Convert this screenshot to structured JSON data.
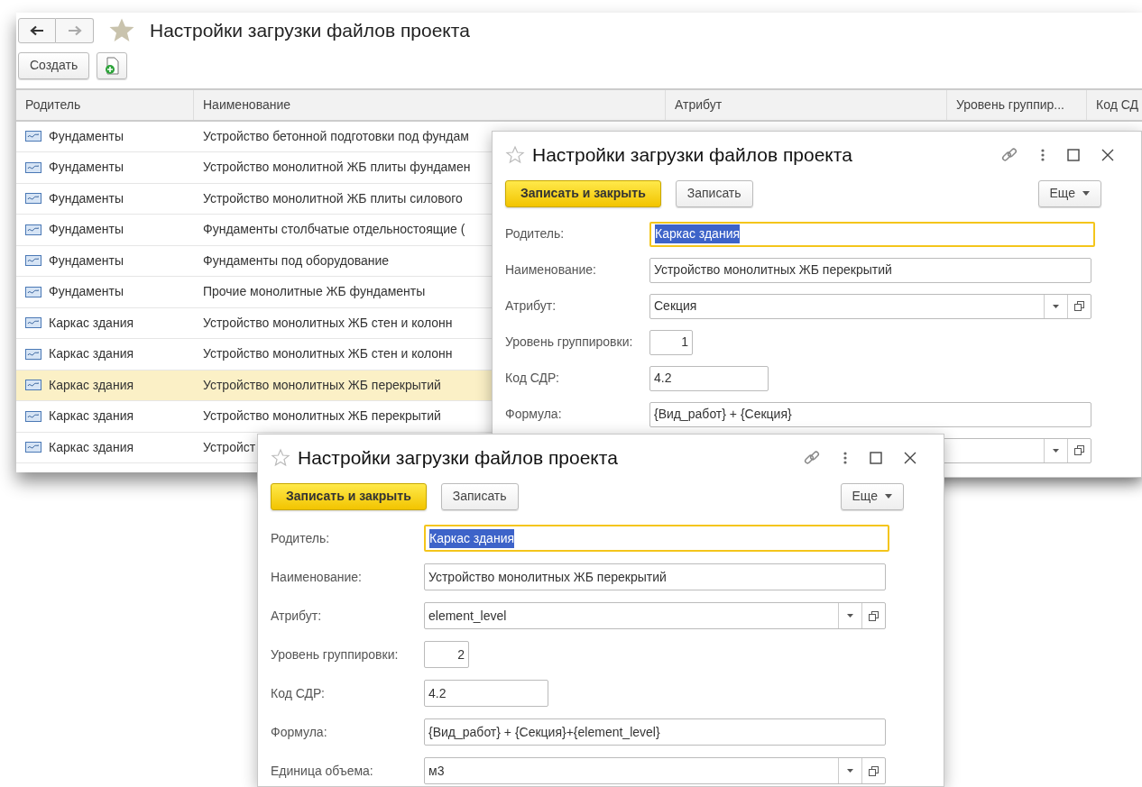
{
  "list_window": {
    "title": "Настройки загрузки файлов проекта",
    "create_button": "Создать",
    "columns": [
      "Родитель",
      "Наименование",
      "Атрибут",
      "Уровень группир...",
      "Код СД"
    ],
    "rows": [
      {
        "parent": "Фундаменты",
        "name": "Устройство бетонной подготовки под фундам",
        "selected": false
      },
      {
        "parent": "Фундаменты",
        "name": "Устройство монолитной ЖБ плиты фундамен",
        "selected": false
      },
      {
        "parent": "Фундаменты",
        "name": "Устройство монолитной ЖБ плиты силового",
        "selected": false
      },
      {
        "parent": "Фундаменты",
        "name": "Фундаменты столбчатые отдельностоящие (",
        "selected": false
      },
      {
        "parent": "Фундаменты",
        "name": "Фундаменты под оборудование",
        "selected": false
      },
      {
        "parent": "Фундаменты",
        "name": "Прочие монолитные ЖБ фундаменты",
        "selected": false
      },
      {
        "parent": "Каркас здания",
        "name": "Устройство монолитных ЖБ стен и колонн",
        "selected": false
      },
      {
        "parent": "Каркас здания",
        "name": "Устройство монолитных ЖБ стен и колонн",
        "selected": false
      },
      {
        "parent": "Каркас здания",
        "name": "Устройство монолитных ЖБ перекрытий",
        "selected": true
      },
      {
        "parent": "Каркас здания",
        "name": "Устройство монолитных ЖБ перекрытий",
        "selected": false
      },
      {
        "parent": "Каркас здания",
        "name": "Устройст",
        "selected": false
      }
    ]
  },
  "dialogs": [
    {
      "title": "Настройки загрузки файлов проекта",
      "save_close_button": "Записать и закрыть",
      "save_button": "Записать",
      "more_button": "Еще",
      "fields": [
        {
          "kind": "text",
          "label": "Родитель:",
          "value": "Каркас здания",
          "focused": true
        },
        {
          "kind": "text",
          "label": "Наименование:",
          "value": "Устройство монолитных ЖБ перекрытий",
          "focused": false
        },
        {
          "kind": "combo",
          "label": "Атрибут:",
          "value": "Секция",
          "focused": false
        },
        {
          "kind": "number",
          "label": "Уровень группировки:",
          "value": "1",
          "focused": false
        },
        {
          "kind": "short",
          "label": "Код СДР:",
          "value": "4.2",
          "focused": false
        },
        {
          "kind": "text",
          "label": "Формула:",
          "value": "{Вид_работ} + {Секция}",
          "focused": false
        },
        {
          "kind": "combo",
          "focused": false
        }
      ]
    },
    {
      "title": "Настройки загрузки файлов проекта",
      "save_close_button": "Записать и закрыть",
      "save_button": "Записать",
      "more_button": "Еще",
      "fields": [
        {
          "kind": "text",
          "label": "Родитель:",
          "value": "Каркас здания",
          "focused": true
        },
        {
          "kind": "text",
          "label": "Наименование:",
          "value": "Устройство монолитных ЖБ перекрытий",
          "focused": false
        },
        {
          "kind": "combo",
          "label": "Атрибут:",
          "value": "element_level",
          "focused": false
        },
        {
          "kind": "number",
          "label": "Уровень группировки:",
          "value": "2",
          "focused": false
        },
        {
          "kind": "short",
          "label": "Код СДР:",
          "value": "4.2",
          "focused": false
        },
        {
          "kind": "text",
          "label": "Формула:",
          "value": "{Вид_работ} + {Секция}+{element_level}",
          "focused": false
        },
        {
          "kind": "combo",
          "label": "Единица объема:",
          "value": "м3",
          "focused": false
        }
      ]
    }
  ]
}
